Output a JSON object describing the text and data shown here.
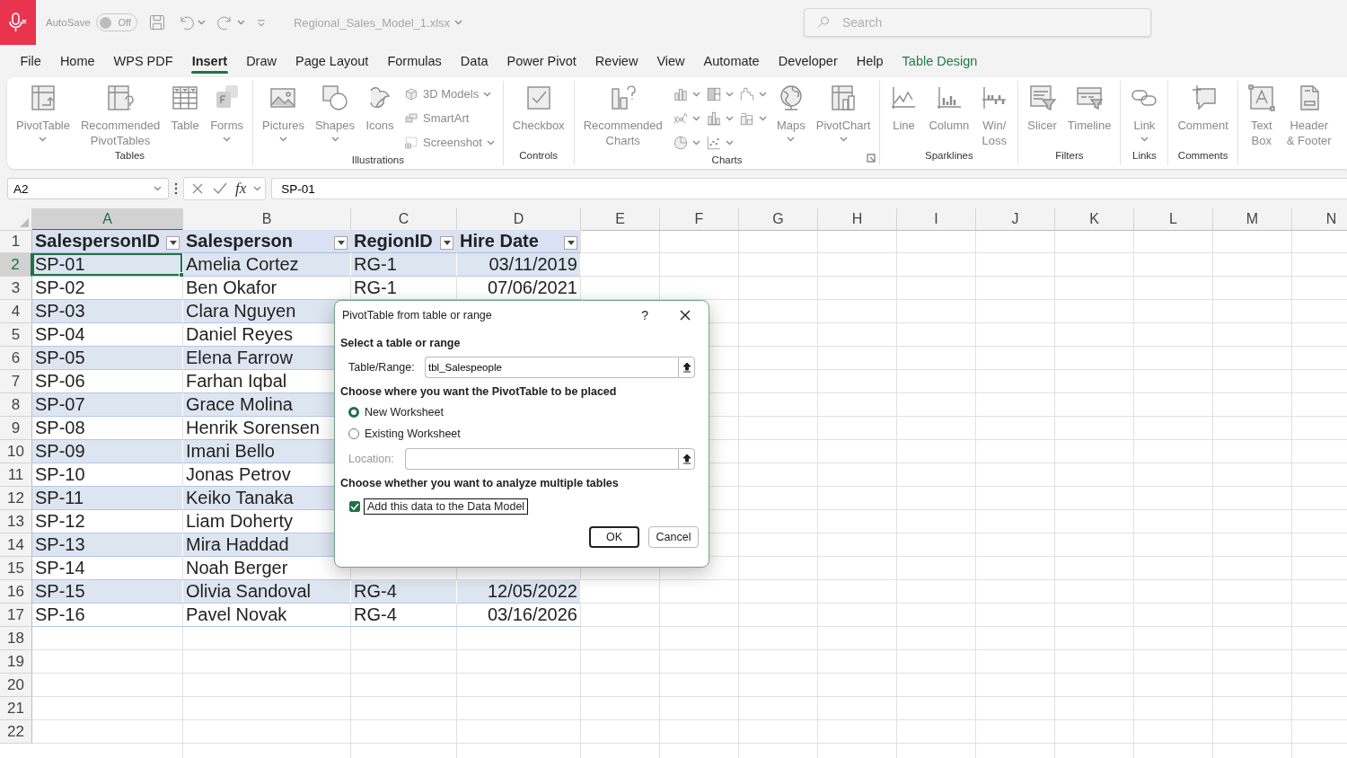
{
  "title_bar": {
    "autosave": {
      "label": "AutoSave",
      "state": "Off",
      "on": false
    },
    "file_name": "Regional_Sales_Model_1.xlsx",
    "search": {
      "placeholder": "Search"
    }
  },
  "menu_tabs": [
    {
      "label": "File",
      "selected": false,
      "kind": "normal"
    },
    {
      "label": "Home",
      "selected": false,
      "kind": "normal"
    },
    {
      "label": "WPS PDF",
      "selected": false,
      "kind": "normal"
    },
    {
      "label": "Insert",
      "selected": true,
      "kind": "normal"
    },
    {
      "label": "Draw",
      "selected": false,
      "kind": "normal"
    },
    {
      "label": "Page Layout",
      "selected": false,
      "kind": "normal"
    },
    {
      "label": "Formulas",
      "selected": false,
      "kind": "normal"
    },
    {
      "label": "Data",
      "selected": false,
      "kind": "normal"
    },
    {
      "label": "Power Pivot",
      "selected": false,
      "kind": "normal"
    },
    {
      "label": "Review",
      "selected": false,
      "kind": "normal"
    },
    {
      "label": "View",
      "selected": false,
      "kind": "normal"
    },
    {
      "label": "Automate",
      "selected": false,
      "kind": "normal"
    },
    {
      "label": "Developer",
      "selected": false,
      "kind": "normal"
    },
    {
      "label": "Help",
      "selected": false,
      "kind": "normal"
    },
    {
      "label": "Table Design",
      "selected": false,
      "kind": "contextual"
    }
  ],
  "ribbon_groups": [
    {
      "label": "Tables",
      "items": [
        {
          "kind": "large",
          "label": "PivotTable",
          "dropdown": true
        },
        {
          "kind": "large",
          "label": "Recommended\nPivotTables"
        },
        {
          "kind": "large",
          "label": "Table"
        },
        {
          "kind": "large",
          "label": "Forms",
          "dropdown": true
        }
      ]
    },
    {
      "label": "Illustrations",
      "items": [
        {
          "kind": "large",
          "label": "Pictures",
          "dropdown": true
        },
        {
          "kind": "large",
          "label": "Shapes",
          "dropdown": true
        },
        {
          "kind": "large",
          "label": "Icons"
        },
        {
          "kind": "small",
          "label": "3D Models",
          "dropdown": true
        },
        {
          "kind": "small",
          "label": "SmartArt"
        },
        {
          "kind": "small",
          "label": "Screenshot",
          "dropdown": true
        }
      ]
    },
    {
      "label": "Controls",
      "items": [
        {
          "kind": "large",
          "label": "Checkbox"
        }
      ]
    },
    {
      "label": "Charts",
      "launcher": true,
      "items": [
        {
          "kind": "large",
          "label": "Recommended\nCharts"
        },
        {
          "kind": "icon",
          "dropdown": true
        },
        {
          "kind": "icon",
          "dropdown": true
        },
        {
          "kind": "icon",
          "dropdown": true
        },
        {
          "kind": "icon",
          "dropdown": true
        },
        {
          "kind": "icon",
          "dropdown": true
        },
        {
          "kind": "icon",
          "dropdown": true
        },
        {
          "kind": "icon",
          "dropdown": true
        },
        {
          "kind": "icon",
          "dropdown": true
        },
        {
          "kind": "large",
          "label": "Maps",
          "dropdown": true
        },
        {
          "kind": "large",
          "label": "PivotChart",
          "dropdown": true
        }
      ]
    },
    {
      "label": "Sparklines",
      "items": [
        {
          "kind": "large",
          "label": "Line"
        },
        {
          "kind": "large",
          "label": "Column"
        },
        {
          "kind": "large",
          "label": "Win/\nLoss"
        }
      ]
    },
    {
      "label": "Filters",
      "items": [
        {
          "kind": "large",
          "label": "Slicer"
        },
        {
          "kind": "large",
          "label": "Timeline"
        }
      ]
    },
    {
      "label": "Links",
      "items": [
        {
          "kind": "large",
          "label": "Link",
          "dropdown": true
        }
      ]
    },
    {
      "label": "Comments",
      "items": [
        {
          "kind": "large",
          "label": "Comment"
        }
      ]
    },
    {
      "items": [
        {
          "kind": "large",
          "label": "Text\nBox"
        },
        {
          "kind": "large",
          "label": "Header\n& Footer"
        }
      ]
    }
  ],
  "formula_bar": {
    "name_box": "A2",
    "function_button": "fx",
    "formula": "SP-01"
  },
  "sheet": {
    "columns": [
      {
        "label": "A",
        "selected": true,
        "kind": "text"
      },
      {
        "label": "B",
        "selected": false,
        "kind": "text"
      },
      {
        "label": "C",
        "selected": false,
        "kind": "text"
      },
      {
        "label": "D",
        "selected": false,
        "kind": "date"
      },
      {
        "label": "E",
        "selected": false,
        "kind": "text"
      },
      {
        "label": "F",
        "selected": false,
        "kind": "text"
      },
      {
        "label": "G",
        "selected": false,
        "kind": "text"
      },
      {
        "label": "H",
        "selected": false,
        "kind": "text"
      },
      {
        "label": "I",
        "selected": false,
        "kind": "text"
      },
      {
        "label": "J",
        "selected": false,
        "kind": "text"
      },
      {
        "label": "K",
        "selected": false,
        "kind": "text"
      },
      {
        "label": "L",
        "selected": false,
        "kind": "text"
      },
      {
        "label": "M",
        "selected": false,
        "kind": "text"
      },
      {
        "label": "N",
        "selected": false,
        "kind": "text"
      }
    ],
    "rows": [
      {
        "label": "1",
        "selected": false,
        "kind": "table_header",
        "cells": [
          "SalespersonID",
          "Salesperson",
          "RegionID",
          "Hire Date"
        ]
      },
      {
        "label": "2",
        "selected": true,
        "kind": "table_row",
        "cells": [
          "SP-01",
          "Amelia Cortez",
          "RG-1",
          "03/11/2019"
        ]
      },
      {
        "label": "3",
        "selected": false,
        "kind": "table_row",
        "cells": [
          "SP-02",
          "Ben Okafor",
          "RG-1",
          "07/06/2021"
        ]
      },
      {
        "label": "4",
        "selected": false,
        "kind": "table_row",
        "cells": [
          "SP-03",
          "Clara Nguyen"
        ]
      },
      {
        "label": "5",
        "selected": false,
        "kind": "table_row",
        "cells": [
          "SP-04",
          "Daniel Reyes"
        ]
      },
      {
        "label": "6",
        "selected": false,
        "kind": "table_row",
        "cells": [
          "SP-05",
          "Elena Farrow"
        ]
      },
      {
        "label": "7",
        "selected": false,
        "kind": "table_row",
        "cells": [
          "SP-06",
          "Farhan Iqbal"
        ]
      },
      {
        "label": "8",
        "selected": false,
        "kind": "table_row",
        "cells": [
          "SP-07",
          "Grace Molina"
        ]
      },
      {
        "label": "9",
        "selected": false,
        "kind": "table_row",
        "cells": [
          "SP-08",
          "Henrik Sorensen"
        ]
      },
      {
        "label": "10",
        "selected": false,
        "kind": "table_row",
        "cells": [
          "SP-09",
          "Imani Bello"
        ]
      },
      {
        "label": "11",
        "selected": false,
        "kind": "table_row",
        "cells": [
          "SP-10",
          "Jonas Petrov"
        ]
      },
      {
        "label": "12",
        "selected": false,
        "kind": "table_row",
        "cells": [
          "SP-11",
          "Keiko Tanaka"
        ]
      },
      {
        "label": "13",
        "selected": false,
        "kind": "table_row",
        "cells": [
          "SP-12",
          "Liam Doherty"
        ]
      },
      {
        "label": "14",
        "selected": false,
        "kind": "table_row",
        "cells": [
          "SP-13",
          "Mira Haddad"
        ]
      },
      {
        "label": "15",
        "selected": false,
        "kind": "table_row",
        "cells": [
          "SP-14",
          "Noah Berger"
        ]
      },
      {
        "label": "16",
        "selected": false,
        "kind": "table_row",
        "cells": [
          "SP-15",
          "Olivia Sandoval",
          "RG-4",
          "12/05/2022"
        ]
      },
      {
        "label": "17",
        "selected": false,
        "kind": "table_row",
        "cells": [
          "SP-16",
          "Pavel Novak",
          "RG-4",
          "03/16/2026"
        ]
      },
      {
        "label": "18",
        "selected": false,
        "kind": "blank"
      },
      {
        "label": "19",
        "selected": false,
        "kind": "blank"
      },
      {
        "label": "20",
        "selected": false,
        "kind": "blank"
      },
      {
        "label": "21",
        "selected": false,
        "kind": "blank"
      },
      {
        "label": "22",
        "selected": false,
        "kind": "blank"
      }
    ]
  },
  "dialog": {
    "title": "PivotTable from table or range",
    "help": "?",
    "section_1": "Select a table or range",
    "range_label": "Table/Range:",
    "range_value": "tbl_Salespeople",
    "section_2": "Choose where you want the PivotTable to be placed",
    "placements": [
      {
        "label": "New Worksheet",
        "selected": true
      },
      {
        "label": "Existing Worksheet",
        "selected": false
      }
    ],
    "location": {
      "label": "Location:",
      "disabled": true
    },
    "section_3": "Choose whether you want to analyze multiple tables",
    "data_model": {
      "label": "Add this data to the Data Model",
      "checked": true
    },
    "buttons": [
      {
        "label": "OK",
        "default": true
      },
      {
        "label": "Cancel",
        "default": false
      }
    ]
  }
}
